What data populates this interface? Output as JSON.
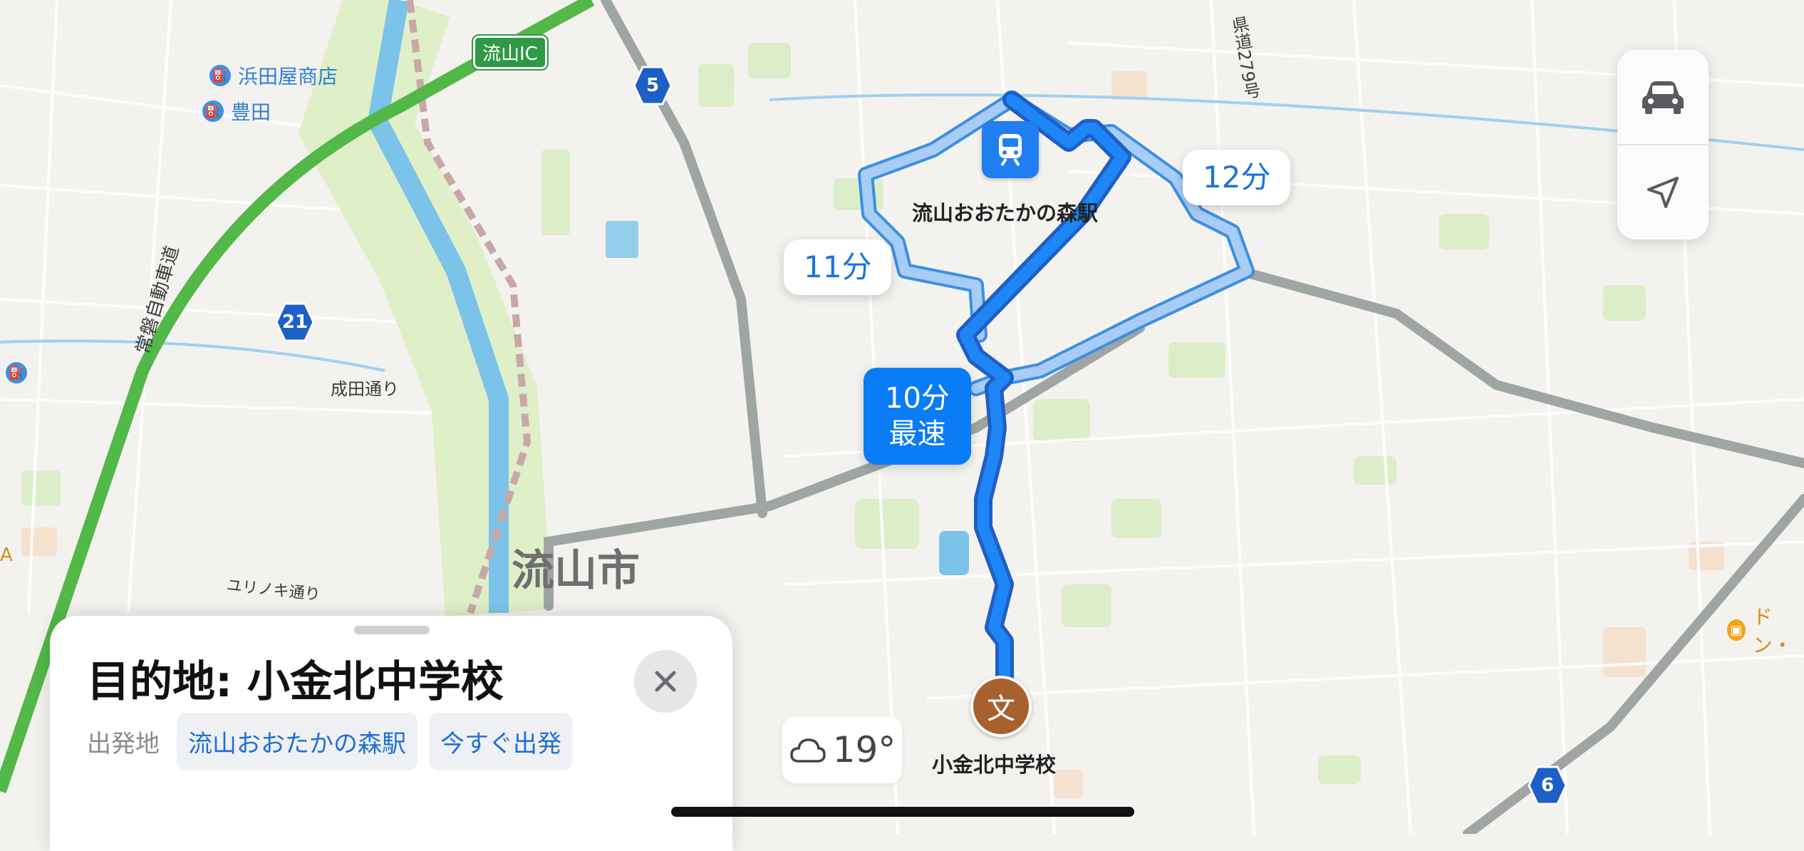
{
  "map": {
    "city_label": "流山市",
    "ic_label": "流山IC",
    "station_label": "流山おおたかの森駅",
    "destination_pin_label": "小金北中学校",
    "road_labels": {
      "narita": "成田通り",
      "yurinoki": "ユリノキ通り",
      "joban": "常磐自動車道",
      "prefectural": "県道279号"
    },
    "pois": [
      {
        "label": "浜田屋商店",
        "icon": "fuel-icon"
      },
      {
        "label": "豊田",
        "icon": "fuel-icon"
      },
      {
        "label": "ドン・",
        "icon": "shopping-bag-icon"
      }
    ],
    "left_edge_label": "A",
    "route_shields": [
      "5",
      "21",
      "6"
    ],
    "colors": {
      "route_primary": "#0a7cf5",
      "route_alt": "#8cc0f5",
      "expressway": "#52b848",
      "river": "#7cc3ea"
    }
  },
  "routes": [
    {
      "duration": "10分",
      "note": "最速",
      "selected": true
    },
    {
      "duration": "11分",
      "selected": false
    },
    {
      "duration": "12分",
      "selected": false
    }
  ],
  "controls": {
    "mode_icon": "car-icon",
    "locate_icon": "location-arrow-icon"
  },
  "sheet": {
    "title": "目的地: 小金北中学校",
    "from_label": "出発地",
    "from_value": "流山おおたかの森駅",
    "depart_value": "今すぐ出発",
    "close_icon": "close-icon"
  },
  "weather": {
    "icon": "cloud-icon",
    "temp": "19°"
  }
}
